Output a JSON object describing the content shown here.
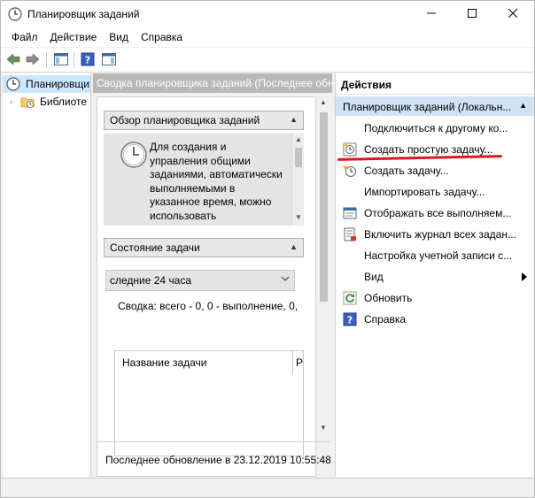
{
  "window": {
    "title": "Планировщик заданий",
    "icon": "clock-icon",
    "controls": [
      "minimize-icon",
      "maximize-icon",
      "close-icon"
    ]
  },
  "menu": [
    "Файл",
    "Действие",
    "Вид",
    "Справка"
  ],
  "toolbar": {
    "buttons": [
      "back-arrow-icon",
      "forward-arrow-icon",
      "show-hide-console-tree-icon",
      "help-icon",
      "show-hide-action-pane-icon"
    ]
  },
  "tree": {
    "items": [
      {
        "label": "Планировщи",
        "icon": "clock-icon",
        "selected": true
      },
      {
        "label": "Библиоте",
        "icon": "folder-clock-icon",
        "selected": false
      }
    ]
  },
  "center": {
    "header": "Сводка планировщика заданий (Последнее обн",
    "overview": {
      "title": "Обзор планировщика заданий",
      "text": "Для создания и управления общими заданиями, автоматически выполняемыми в указанное время, можно использовать"
    },
    "status": {
      "title": "Состояние задачи",
      "period": "следние 24 часа",
      "summary": "Сводка: всего - 0, 0 - выполнение, 0,",
      "column": "Название задачи",
      "column2": "Р"
    },
    "footer": "Последнее обновление в 23.12.2019 10:55:48"
  },
  "actions": {
    "title": "Действия",
    "group": "Планировщик заданий (Локальн...",
    "items": [
      {
        "label": "Подключиться к другому ко...",
        "icon": ""
      },
      {
        "label": "Создать простую задачу...",
        "icon": "create-basic-task-icon"
      },
      {
        "label": "Создать задачу...",
        "icon": "create-task-icon"
      },
      {
        "label": "Импортировать задачу...",
        "icon": ""
      },
      {
        "label": "Отображать все выполняем...",
        "icon": "running-tasks-icon"
      },
      {
        "label": "Включить журнал всех задан...",
        "icon": "enable-history-icon"
      },
      {
        "label": "Настройка учетной записи с...",
        "icon": ""
      },
      {
        "label": "Вид",
        "icon": "",
        "submenu": true
      },
      {
        "label": "Обновить",
        "icon": "refresh-icon"
      },
      {
        "label": "Справка",
        "icon": "help-icon"
      }
    ]
  },
  "colors": {
    "selection": "#cce8ff",
    "group_header": "#cfe3f5",
    "center_header": "#b8b8b8",
    "highlight_underline": "#e0161e"
  }
}
